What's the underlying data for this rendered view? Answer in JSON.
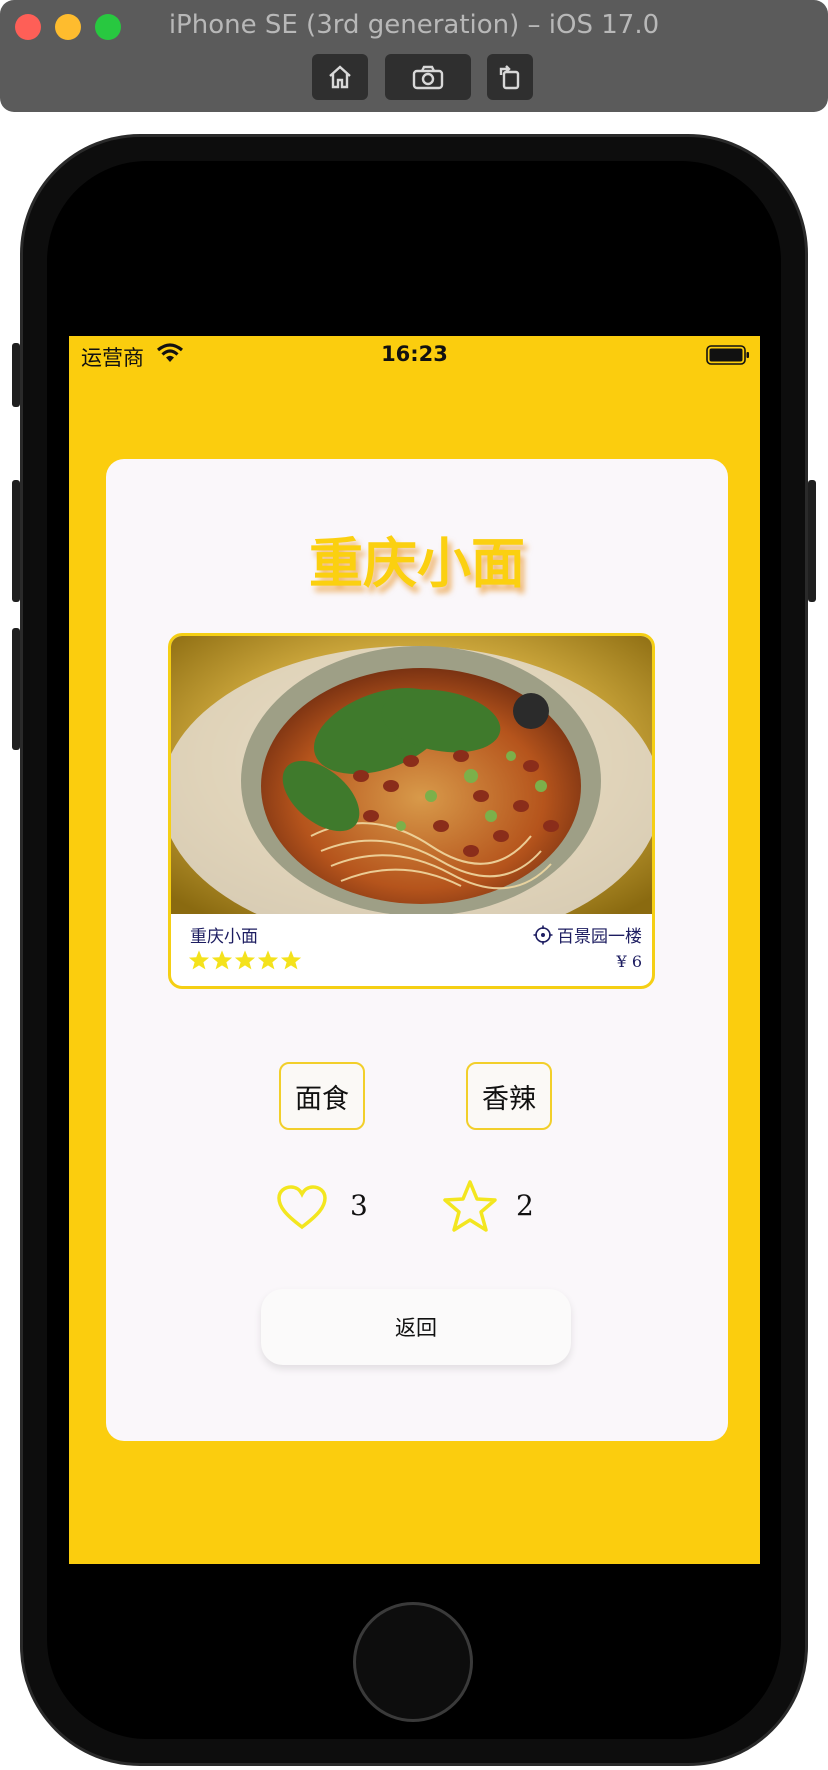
{
  "window": {
    "title": "iPhone SE (3rd generation) – iOS 17.0",
    "toolbar_icons": [
      "home-icon",
      "screenshot-icon",
      "rotate-icon"
    ]
  },
  "status_bar": {
    "carrier": "运营商",
    "time": "16:23"
  },
  "page": {
    "title": "重庆小面",
    "food_card": {
      "name": "重庆小面",
      "location": "百景园一楼",
      "price": "¥ 6",
      "rating": 5,
      "rating_max": 5
    },
    "tags": [
      "面食",
      "香辣"
    ],
    "likes": "3",
    "favorites": "2",
    "back_label": "返回"
  },
  "colors": {
    "accent": "#fbcd0e",
    "card_bg": "#faf7fa",
    "title": "#fbd010",
    "text_dark": "#1c1c60"
  }
}
